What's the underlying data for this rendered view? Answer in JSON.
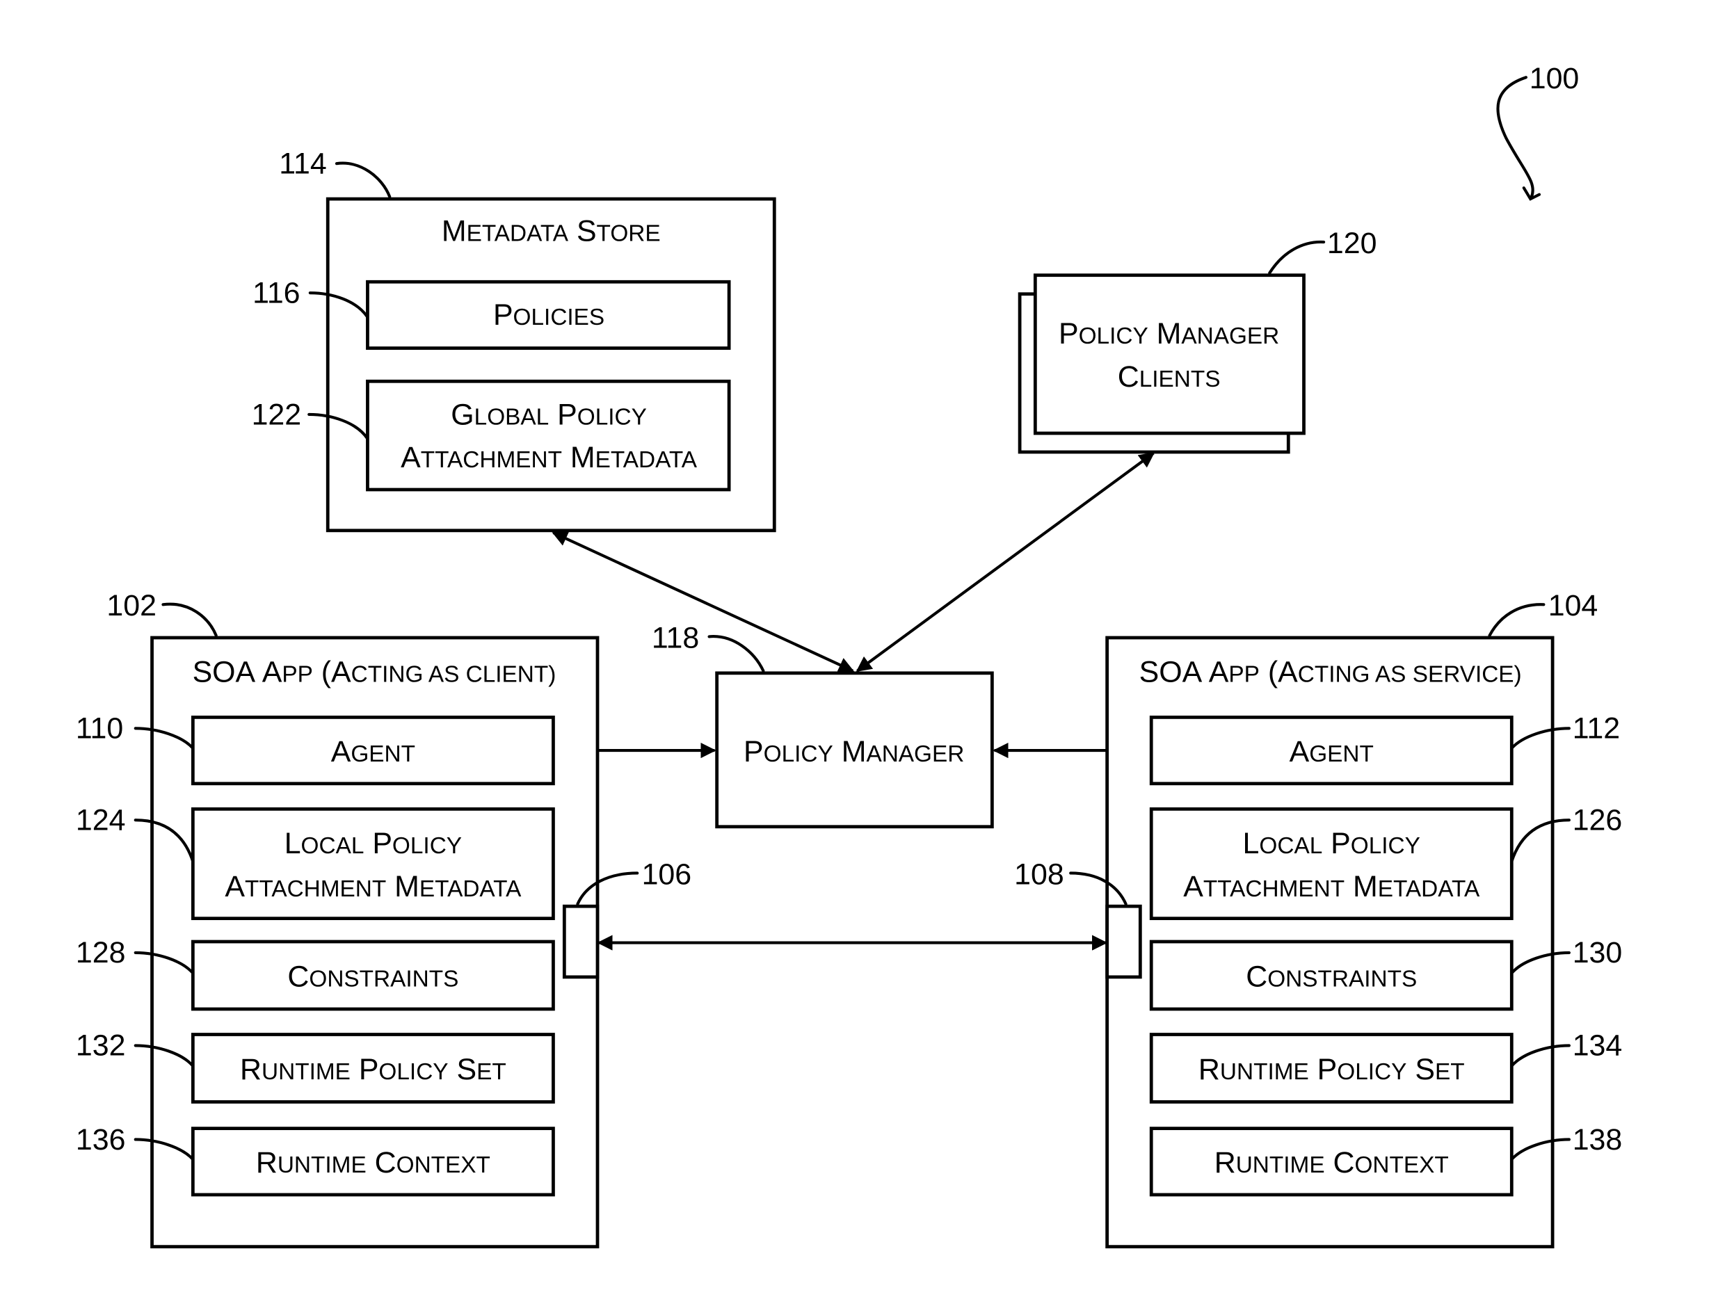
{
  "figure": {
    "ref": "100",
    "colors": {
      "line": "#000000",
      "background": "#ffffff"
    }
  },
  "metadata_store": {
    "ref": "114",
    "title": [
      [
        "M",
        "ETADATA"
      ],
      [
        "S",
        "TORE"
      ]
    ],
    "items": [
      {
        "ref": "116",
        "lines": [
          [
            [
              "P",
              "OLICIES"
            ]
          ]
        ]
      },
      {
        "ref": "122",
        "lines": [
          [
            [
              "G",
              "LOBAL"
            ],
            [
              "P",
              "OLICY"
            ]
          ],
          [
            [
              "A",
              "TTACHMENT"
            ],
            [
              "M",
              "ETADATA"
            ]
          ]
        ]
      }
    ]
  },
  "policy_manager_clients": {
    "ref": "120",
    "lines": [
      [
        [
          "P",
          "OLICY"
        ],
        [
          "M",
          "ANAGER"
        ]
      ],
      [
        [
          "C",
          "LIENTS"
        ]
      ]
    ]
  },
  "policy_manager": {
    "ref": "118",
    "lines": [
      [
        [
          "P",
          "OLICY"
        ],
        [
          "M",
          "ANAGER"
        ]
      ]
    ]
  },
  "client_app": {
    "ref": "102",
    "title": "SOA App (Acting as client)",
    "title_parts": [
      [
        "SOA",
        ""
      ],
      [
        "A",
        "PP"
      ],
      [
        "(A",
        "CTING AS CLIENT)"
      ]
    ],
    "port_ref": "106",
    "items": [
      {
        "ref": "110",
        "lines": [
          [
            [
              "A",
              "GENT"
            ]
          ]
        ]
      },
      {
        "ref": "124",
        "lines": [
          [
            [
              "L",
              "OCAL"
            ],
            [
              "P",
              "OLICY"
            ]
          ],
          [
            [
              "A",
              "TTACHMENT"
            ],
            [
              "M",
              "ETADATA"
            ]
          ]
        ]
      },
      {
        "ref": "128",
        "lines": [
          [
            [
              "C",
              "ONSTRAINTS"
            ]
          ]
        ]
      },
      {
        "ref": "132",
        "lines": [
          [
            [
              "R",
              "UNTIME"
            ],
            [
              "P",
              "OLICY"
            ],
            [
              "S",
              "ET"
            ]
          ]
        ]
      },
      {
        "ref": "136",
        "lines": [
          [
            [
              "R",
              "UNTIME"
            ],
            [
              "C",
              "ONTEXT"
            ]
          ]
        ]
      }
    ]
  },
  "service_app": {
    "ref": "104",
    "title": "SOA App (Acting as service)",
    "title_parts": [
      [
        "SOA",
        ""
      ],
      [
        "A",
        "PP"
      ],
      [
        "(A",
        "CTING AS SERVICE)"
      ]
    ],
    "port_ref": "108",
    "items": [
      {
        "ref": "112",
        "lines": [
          [
            [
              "A",
              "GENT"
            ]
          ]
        ]
      },
      {
        "ref": "126",
        "lines": [
          [
            [
              "L",
              "OCAL"
            ],
            [
              "P",
              "OLICY"
            ]
          ],
          [
            [
              "A",
              "TTACHMENT"
            ],
            [
              "M",
              "ETADATA"
            ]
          ]
        ]
      },
      {
        "ref": "130",
        "lines": [
          [
            [
              "C",
              "ONSTRAINTS"
            ]
          ]
        ]
      },
      {
        "ref": "134",
        "lines": [
          [
            [
              "R",
              "UNTIME"
            ],
            [
              "P",
              "OLICY"
            ],
            [
              "S",
              "ET"
            ]
          ]
        ]
      },
      {
        "ref": "138",
        "lines": [
          [
            [
              "R",
              "UNTIME"
            ],
            [
              "C",
              "ONTEXT"
            ]
          ]
        ]
      }
    ]
  },
  "connections": [
    {
      "from": "118",
      "to": "114",
      "type": "bidirectional"
    },
    {
      "from": "118",
      "to": "120",
      "type": "bidirectional"
    },
    {
      "from": "118",
      "to": "110",
      "type": "bidirectional"
    },
    {
      "from": "118",
      "to": "112",
      "type": "bidirectional"
    },
    {
      "from": "106",
      "to": "108",
      "type": "bidirectional"
    }
  ]
}
